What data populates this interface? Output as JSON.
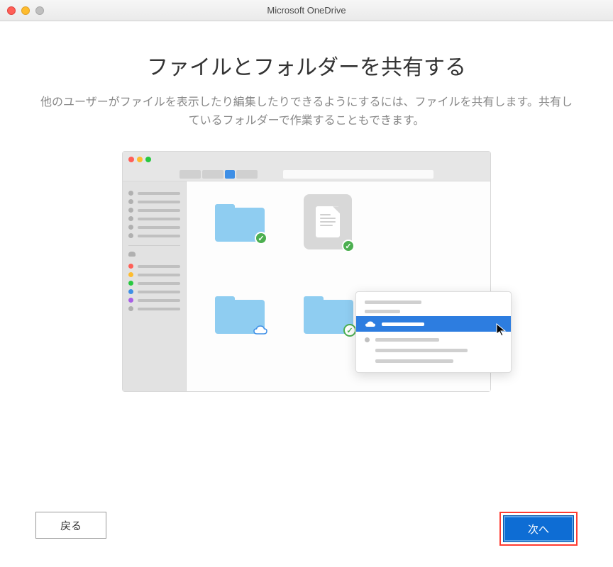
{
  "window": {
    "title": "Microsoft OneDrive"
  },
  "heading": "ファイルとフォルダーを共有する",
  "subtitle": "他のユーザーがファイルを表示したり編集したりできるようにするには、ファイルを共有します。共有しているフォルダーで作業することもできます。",
  "buttons": {
    "back": "戻る",
    "next": "次へ"
  },
  "colors": {
    "primary_button": "#0e6dd4",
    "highlight_border": "#ff3b30",
    "folder": "#8fcdf1",
    "check_badge": "#4caf50",
    "menu_highlight": "#2d7de0"
  }
}
